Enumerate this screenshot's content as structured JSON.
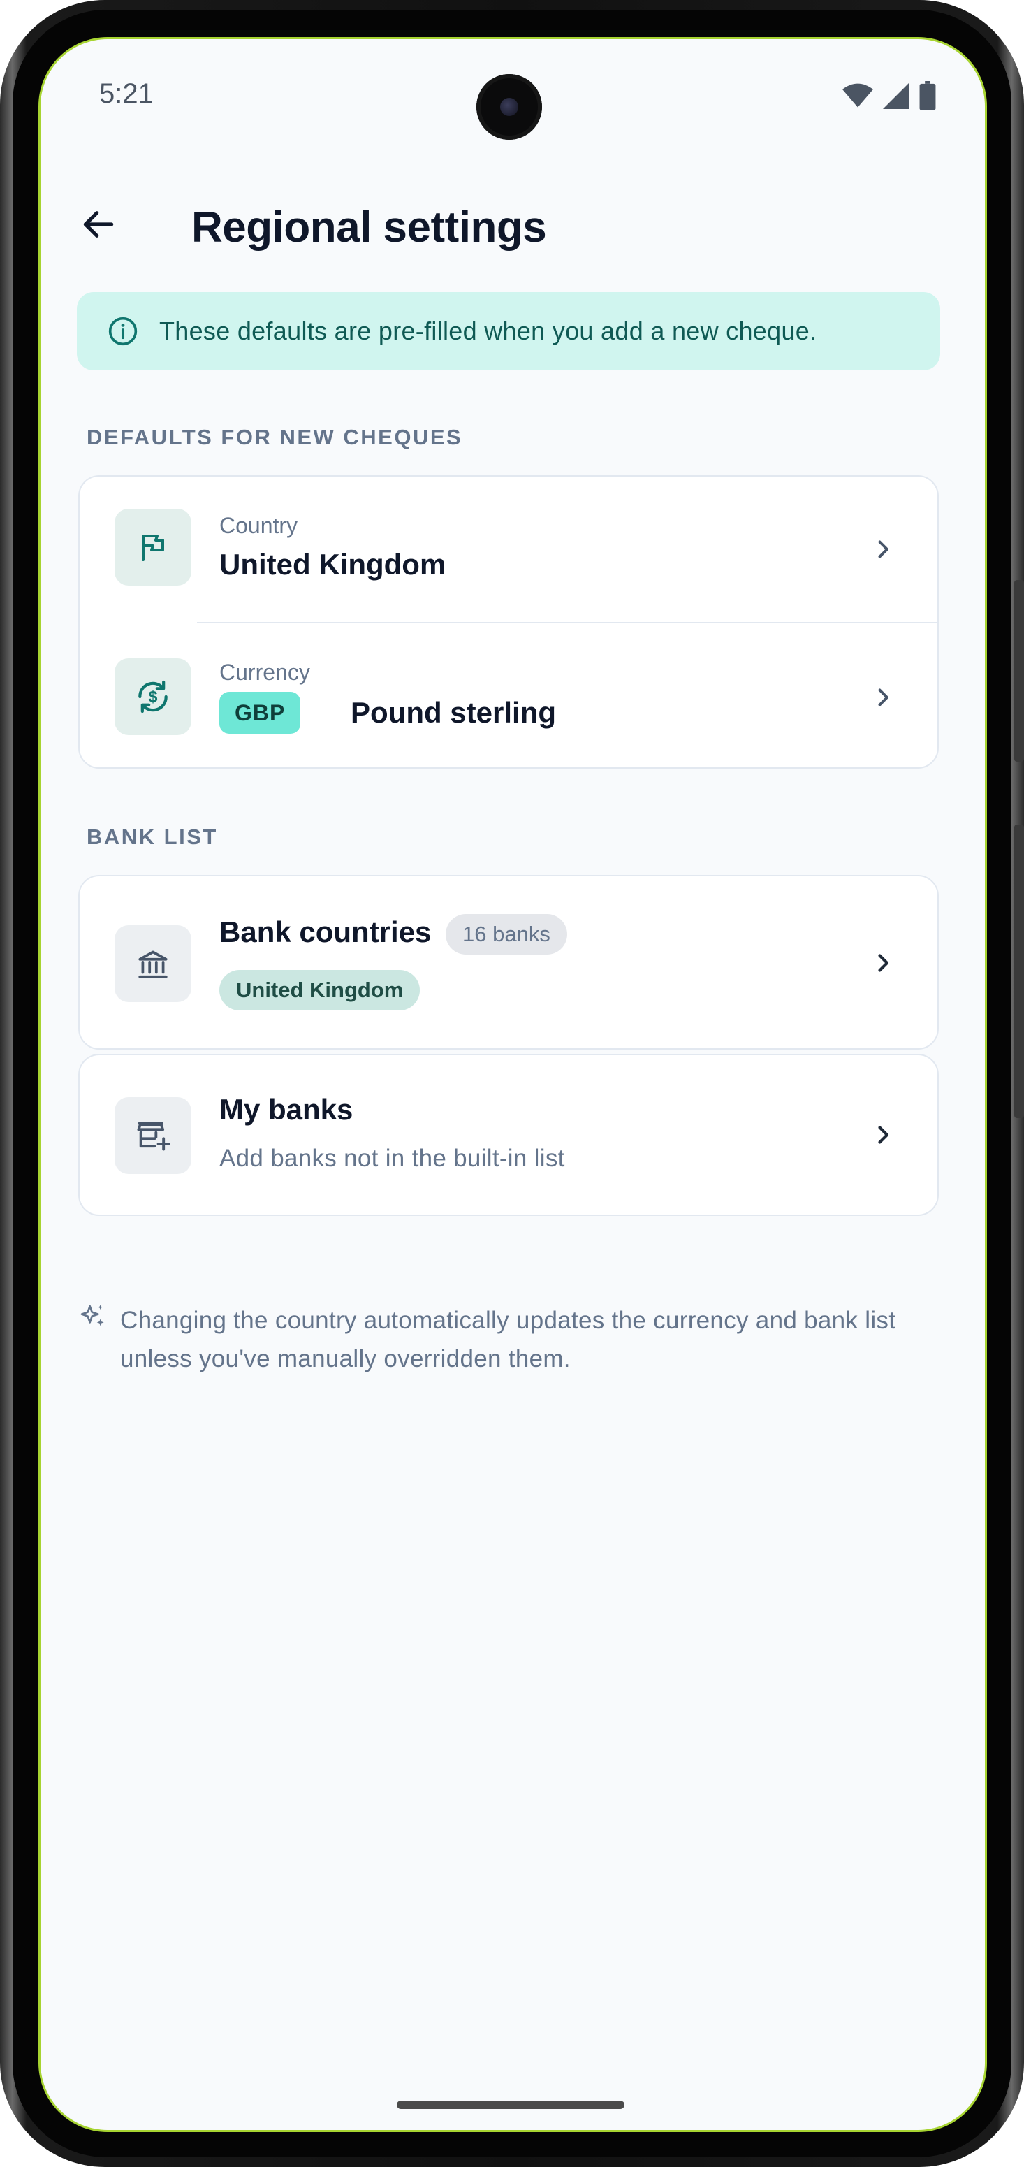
{
  "status_bar": {
    "time": "5:21"
  },
  "header": {
    "title": "Regional settings"
  },
  "info_banner": {
    "text": "These defaults are pre-filled when you add a new cheque."
  },
  "sections": {
    "defaults": {
      "label": "DEFAULTS FOR NEW CHEQUES",
      "country": {
        "label": "Country",
        "value": "United Kingdom"
      },
      "currency": {
        "label": "Currency",
        "code": "GBP",
        "value": "Pound sterling"
      }
    },
    "bank_list": {
      "label": "BANK LIST",
      "bank_countries": {
        "title": "Bank countries",
        "count": "16 banks",
        "country": "United Kingdom"
      },
      "my_banks": {
        "title": "My banks",
        "subtitle": "Add banks not in the built-in list"
      }
    }
  },
  "footnote": "Changing the country automatically updates the currency and bank list unless you've manually overridden them.",
  "icons": [
    "back-arrow-icon",
    "info-icon",
    "flag-icon",
    "currency-exchange-icon",
    "bank-icon",
    "store-add-icon",
    "chevron-right-icon",
    "sparkle-icon",
    "wifi-icon",
    "signal-icon",
    "battery-icon"
  ],
  "colors": {
    "accent": "#0f766e",
    "banner_bg": "#d0f5ef",
    "chip_gbp": "#6ee7d6",
    "screen_bg": "#f8fafc"
  }
}
